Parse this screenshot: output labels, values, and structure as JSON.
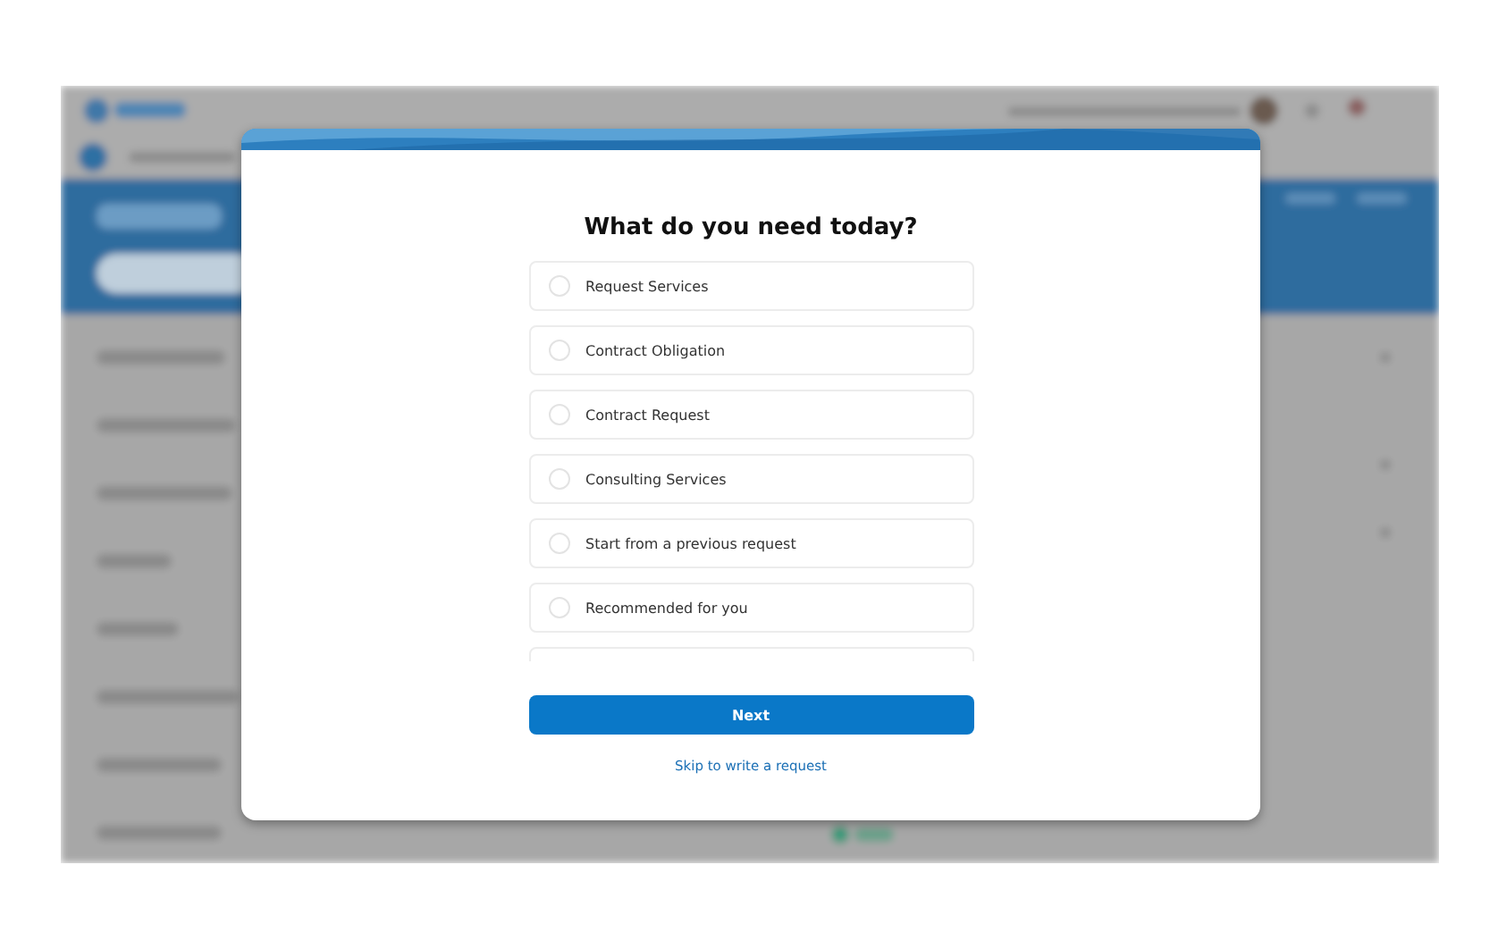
{
  "dialog": {
    "title": "What do you need today?",
    "options": [
      {
        "label": "Request Services",
        "selected": false
      },
      {
        "label": "Contract Obligation",
        "selected": false
      },
      {
        "label": "Contract Request",
        "selected": false
      },
      {
        "label": "Consulting Services",
        "selected": false
      },
      {
        "label": "Start from a previous request",
        "selected": false
      },
      {
        "label": "Recommended for you",
        "selected": false
      }
    ],
    "primary_button": "Next",
    "link": "Skip to write a request"
  }
}
